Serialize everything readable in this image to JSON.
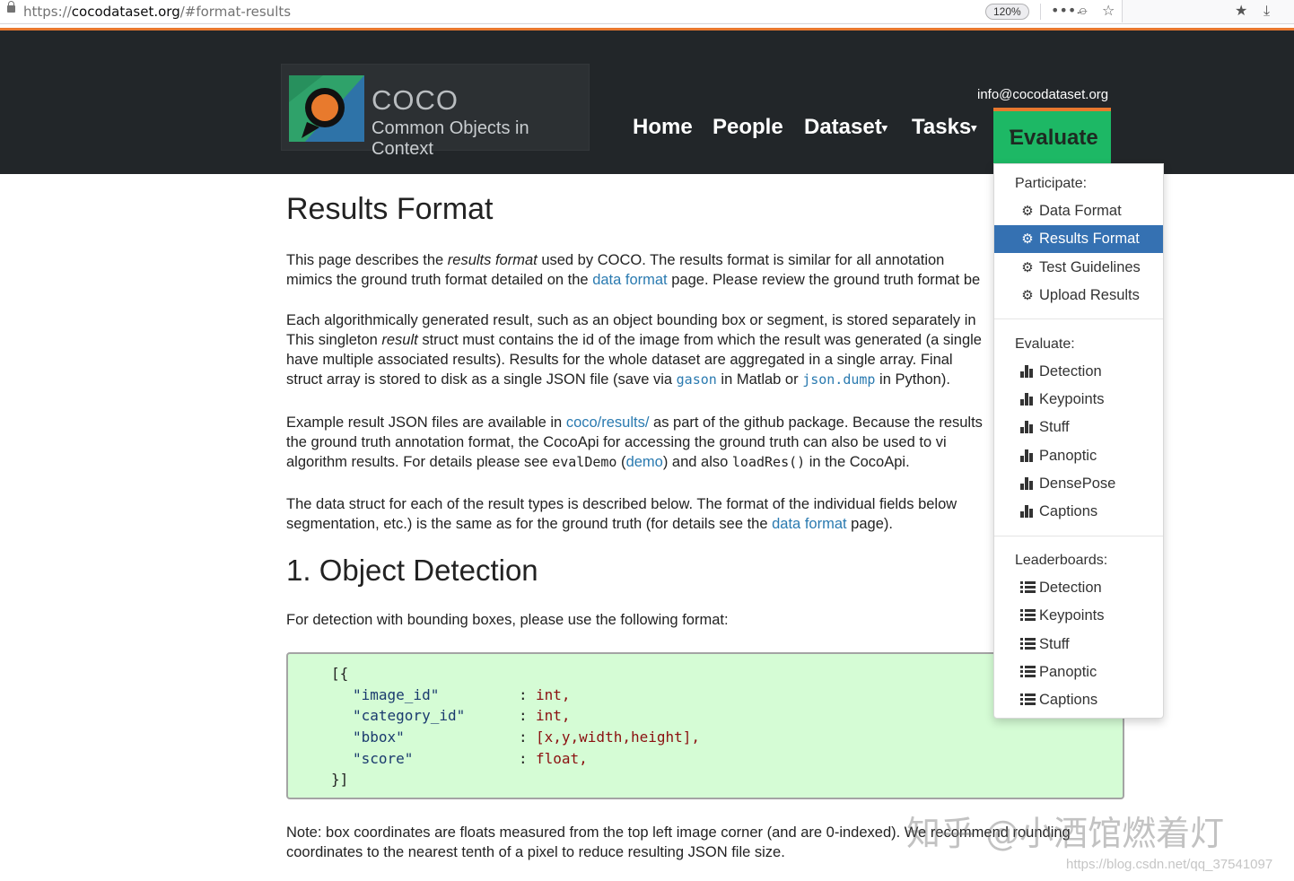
{
  "browser": {
    "url_prefix": "https://",
    "url_host": "cocodataset.org",
    "url_path": "/#format-results",
    "zoom": "120%"
  },
  "header": {
    "logo_title": "COCO",
    "logo_subtitle": "Common Objects in Context",
    "email": "info@cocodataset.org",
    "nav": {
      "home": "Home",
      "people": "People",
      "dataset": "Dataset",
      "tasks": "Tasks",
      "evaluate": "Evaluate"
    }
  },
  "dropdown": {
    "participate_header": "Participate:",
    "participate": [
      "Data Format",
      "Results Format",
      "Test Guidelines",
      "Upload Results"
    ],
    "evaluate_header": "Evaluate:",
    "evaluate": [
      "Detection",
      "Keypoints",
      "Stuff",
      "Panoptic",
      "DensePose",
      "Captions"
    ],
    "leaderboards_header": "Leaderboards:",
    "leaderboards": [
      "Detection",
      "Keypoints",
      "Stuff",
      "Panoptic",
      "Captions"
    ]
  },
  "content": {
    "title": "Results Format",
    "p1": {
      "a": "This page describes the ",
      "em": "results format",
      "b": " used by COCO. The results format is similar for all annotation",
      "c": "mimics the ground truth format detailed on the ",
      "link": "data format",
      "d": " page. Please review the ground truth format be"
    },
    "p2": {
      "l1": "Each algorithmically generated result, such as an object bounding box or segment, is stored separately in",
      "l2a": "This singleton ",
      "l2em": "result",
      "l2b": " struct must contains the id of the image from which the result was generated (a single",
      "l3": "have multiple associated results). Results for the whole dataset are aggregated in a single array. Final",
      "l4a": "struct array is stored to disk as a single JSON file (save via ",
      "l4code1": "gason",
      "l4b": " in Matlab or ",
      "l4code2": "json.dump",
      "l4c": " in Python)."
    },
    "p3": {
      "l1a": "Example result JSON files are available in ",
      "l1link": "coco/results/",
      "l1b": " as part of the github package. Because the results",
      "l2": "the ground truth annotation format, the CocoApi for accessing the ground truth can also be used to vi",
      "l3a": "algorithm results. For details please see ",
      "l3code1": "evalDemo",
      "l3b": " (",
      "l3link": "demo",
      "l3c": ") and also ",
      "l3code2": "loadRes()",
      "l3d": " in the CocoApi."
    },
    "p4": {
      "l1": "The data struct for each of the result types is described below. The format of the individual fields below",
      "l2a": "segmentation, etc.) is the same as for the ground truth (for details see the ",
      "l2link": "data format",
      "l2b": " page)."
    },
    "section_title": "1. Object Detection",
    "detection_intro": "For detection with bounding boxes, please use the following format:",
    "code": {
      "open": "[{",
      "keys": [
        "\"image_id\"",
        "\"category_id\"",
        "\"bbox\"",
        "\"score\""
      ],
      "values": [
        "int,",
        "int,",
        "[x,y,width,height],",
        "float,"
      ],
      "colon": ":",
      "close": "}]"
    },
    "note": {
      "l1": "Note: box coordinates are floats measured from the top left image corner (and are 0-indexed). We recommend rounding",
      "l2": "coordinates to the nearest tenth of a pixel to reduce resulting JSON file size."
    }
  },
  "watermark": {
    "main": "知乎 @小酒馆燃着灯",
    "url": "https://blog.csdn.net/qq_37541097"
  },
  "colors": {
    "header_bg": "#222629",
    "accent_orange": "#e8782f",
    "evaluate_green": "#1db865",
    "active_blue": "#3571b2",
    "link_blue": "#2a7ab0",
    "code_bg": "#d5fcd5"
  }
}
